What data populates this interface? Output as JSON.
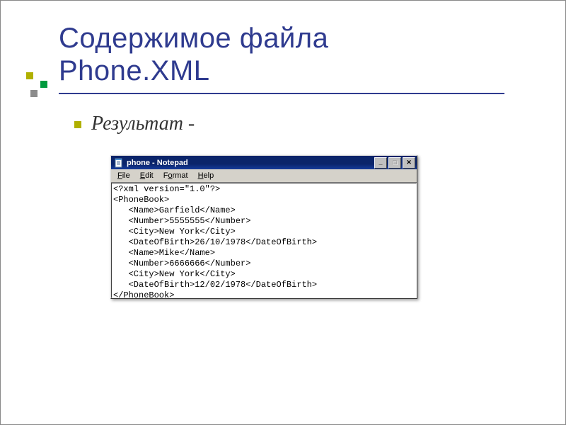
{
  "slide": {
    "title_line1": "Содержимое файла",
    "title_line2": "Phone.XML",
    "bullet_text": "Результат -"
  },
  "notepad": {
    "title": "phone - Notepad",
    "menu": {
      "file": "File",
      "edit": "Edit",
      "format": "Format",
      "help": "Help"
    },
    "buttons": {
      "min_glyph": "_",
      "max_glyph": "□",
      "close_glyph": "✕"
    },
    "icon": "notepad-icon",
    "content_lines": [
      "<?xml version=\"1.0\"?>",
      "<PhoneBook>",
      "   <Name>Garfield</Name>",
      "   <Number>5555555</Number>",
      "   <City>New York</City>",
      "   <DateOfBirth>26/10/1978</DateOfBirth>",
      "   <Name>Mike</Name>",
      "   <Number>6666666</Number>",
      "   <City>New York</City>",
      "   <DateOfBirth>12/02/1978</DateOfBirth>",
      "</PhoneBook>"
    ]
  }
}
